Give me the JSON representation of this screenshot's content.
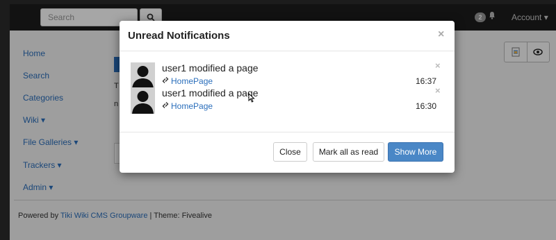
{
  "navbar": {
    "search_placeholder": "Search",
    "notification_count": "2",
    "account_label": "Account ▾"
  },
  "sidebar": {
    "items": [
      {
        "label": "Home"
      },
      {
        "label": "Search"
      },
      {
        "label": "Categories"
      },
      {
        "label": "Wiki ▾"
      },
      {
        "label": "File Galleries ▾"
      },
      {
        "label": "Trackers ▾"
      },
      {
        "label": "Admin ▾"
      }
    ]
  },
  "content": {
    "text1": "T",
    "text2": "n"
  },
  "footer": {
    "prefix": "Powered by ",
    "link": "Tiki Wiki CMS Groupware",
    "suffix": " | Theme: Fivealive"
  },
  "modal": {
    "title": "Unread Notifications",
    "close_symbol": "×",
    "notifications": [
      {
        "title": "user1 modified a page",
        "link": "HomePage",
        "time": "16:37"
      },
      {
        "title": "user1 modified a page",
        "link": "HomePage",
        "time": "16:30"
      }
    ],
    "buttons": {
      "close": "Close",
      "mark_all": "Mark all as read",
      "show_more": "Show More"
    }
  },
  "colors": {
    "link": "#2a6ebb",
    "primary": "#4a87c6",
    "navbar": "#1d1d1d"
  }
}
